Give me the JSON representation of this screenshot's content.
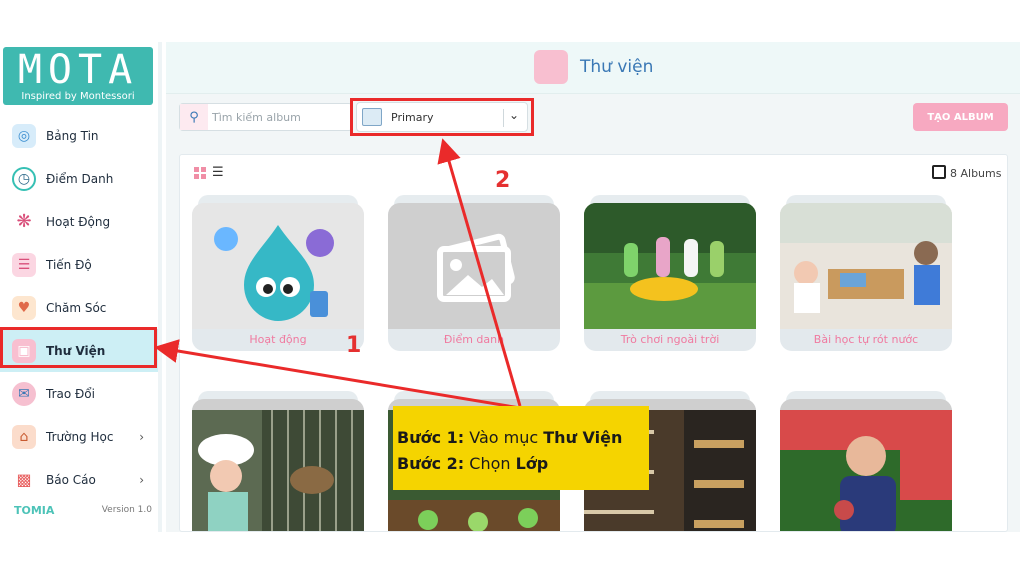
{
  "sidebar": {
    "logo": {
      "title": "MOTA",
      "subtitle": "Inspired by Montessori"
    },
    "items": [
      {
        "label": "Bảng Tin",
        "icon": "globe-icon",
        "color": "#4aa3df"
      },
      {
        "label": "Điểm Danh",
        "icon": "clock-icon",
        "color": "#36c0b4"
      },
      {
        "label": "Hoạt Động",
        "icon": "atom-icon",
        "color": "#d94f7a"
      },
      {
        "label": "Tiến Độ",
        "icon": "book-icon",
        "color": "#e35d8a"
      },
      {
        "label": "Chăm Sóc",
        "icon": "hand-heart-icon",
        "color": "#f2a654"
      },
      {
        "label": "Thư Viện",
        "icon": "library-icon",
        "color": "#f28aa8"
      },
      {
        "label": "Trao Đổi",
        "icon": "chat-icon",
        "color": "#5aa0e0"
      },
      {
        "label": "Trường Học",
        "icon": "school-icon",
        "color": "#e47a4a"
      },
      {
        "label": "Báo Cáo",
        "icon": "chart-icon",
        "color": "#e86060"
      }
    ],
    "footer": {
      "brand": "TOMIA",
      "version": "Version 1.0"
    }
  },
  "header": {
    "title": "Thư viện",
    "icon": "library-icon"
  },
  "toolbar": {
    "search_placeholder": "Tìm kiếm album",
    "class_select_value": "Primary",
    "create_label": "TẠO ALBUM"
  },
  "gallery": {
    "album_count": "8 Albums",
    "albums": [
      {
        "caption": "Hoạt động",
        "thumb": "mascot"
      },
      {
        "caption": "Điểm danh",
        "thumb": "placeholder"
      },
      {
        "caption": "Trò chơi ngoài trời",
        "thumb": "photo-outdoor-kids"
      },
      {
        "caption": "Bài học tự rót nước",
        "thumb": "photo-classroom"
      },
      {
        "caption": "",
        "thumb": "photo-feeding-animals"
      },
      {
        "caption": "",
        "thumb": "photo-plants"
      },
      {
        "caption": "",
        "thumb": "photo-store-shelves"
      },
      {
        "caption": "",
        "thumb": "photo-boy-playing"
      }
    ]
  },
  "annotation": {
    "step1_prefix": "Bước 1:",
    "step1_text": "Vào mục",
    "step1_target": "Thư Viện",
    "step2_prefix": "Bước 2:",
    "step2_text": "Chọn",
    "step2_target": "Lớp",
    "marker1": "1",
    "marker2": "2"
  },
  "colors": {
    "accent": "#3fb9b0",
    "highlight": "#ea2a2a",
    "annotation_bg": "#f5d400",
    "caption": "#f07aa0"
  }
}
